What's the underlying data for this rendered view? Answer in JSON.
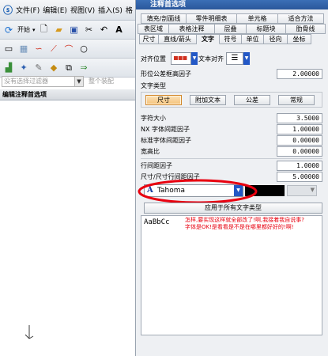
{
  "app": {
    "menu": [
      "文件(F)",
      "编辑(E)",
      "视图(V)",
      "插入(S)",
      "格"
    ],
    "start_label": "开始",
    "selection_filter": "没有选择过滤器",
    "assembly_label": "整个装配",
    "edit_bar_label": "编辑注释首选项"
  },
  "dialog": {
    "title": "注释首选项",
    "tabs_row1": [
      "填充/剖面线",
      "零件明细表",
      "单元格",
      "适合方法"
    ],
    "tabs_row2": [
      "表区域",
      "表格注释",
      "层叠",
      "标题块",
      "肋骨线"
    ],
    "tabs_row3": [
      "尺寸",
      "直线/箭头",
      "文字",
      "符号",
      "单位",
      "径向",
      "坐标"
    ],
    "active_tab": "文字",
    "align_position_label": "对齐位置",
    "text_align_label": "文本对齐",
    "form_tolerance_label": "形位公差框高因子",
    "form_tolerance_value": "2.00000",
    "text_type_label": "文字类型",
    "text_type_buttons": [
      "尺寸",
      "附加文本",
      "公差",
      "常规"
    ],
    "active_text_type": "尺寸",
    "fields": [
      {
        "label": "字符大小",
        "value": "3.5000"
      },
      {
        "label": "NX 字体间距因子",
        "value": "1.00000"
      },
      {
        "label": "标准字体间距因子",
        "value": "0.00000"
      },
      {
        "label": "宽高比",
        "value": "0.00000"
      }
    ],
    "line_fields": [
      {
        "label": "行间距因子",
        "value": "1.0000"
      },
      {
        "label": "尺寸/尺寸行间距因子",
        "value": "5.00000"
      }
    ],
    "font_name": "Tahoma",
    "apply_all_button": "应用于所有文字类型",
    "preview_text": "AaBbCc",
    "annotation_line1": "怎样,要实现这样就全部改了!啊,我接着我自说事?",
    "annotation_line2": "字体是OK!是看看是不是在哪里都好好的!啊!",
    "colors": {
      "accent": "#f5c27a",
      "red": "#e8000f",
      "dialog_bg": "#eef0f3"
    }
  }
}
